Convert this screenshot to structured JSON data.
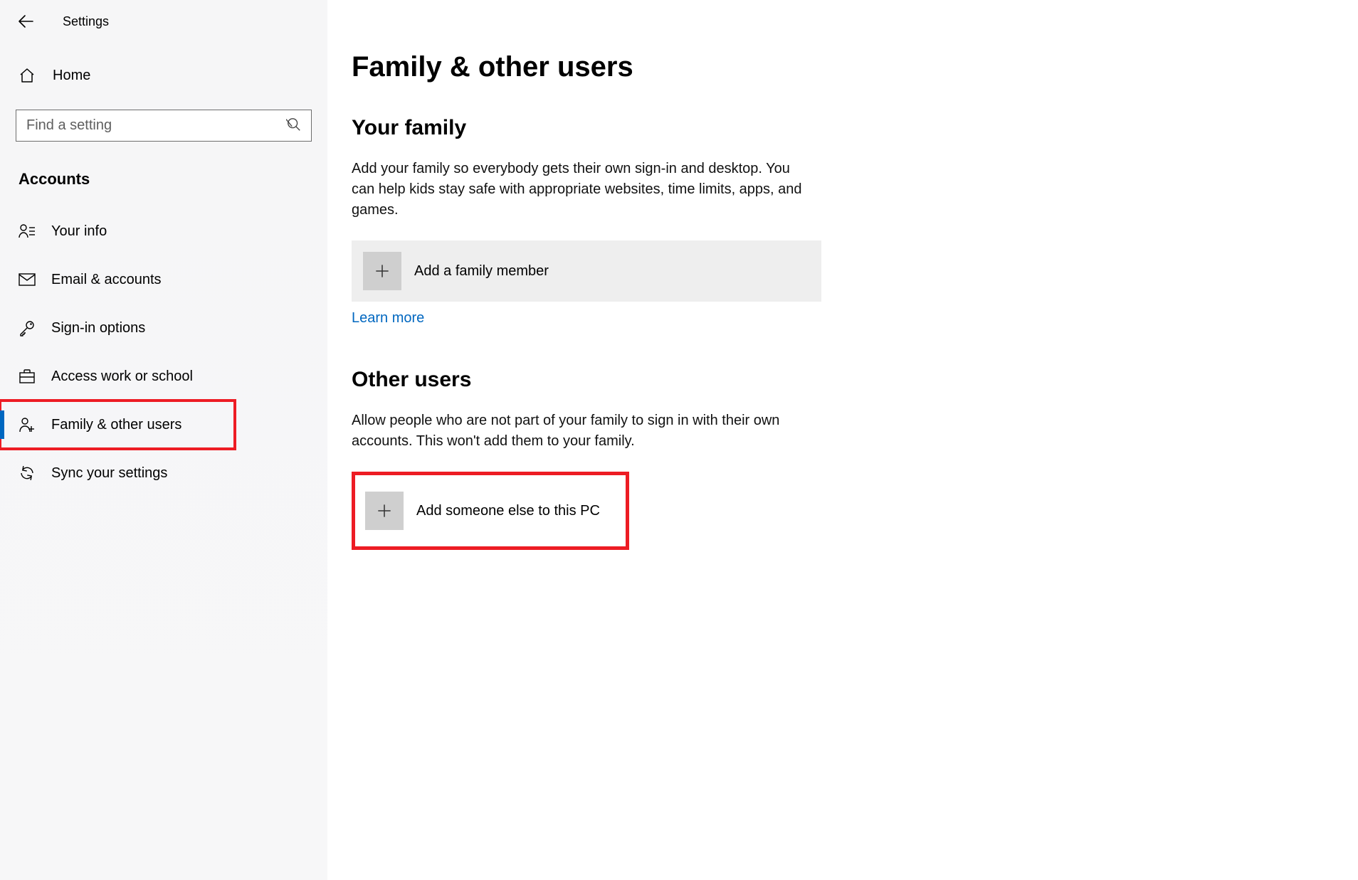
{
  "app": {
    "title": "Settings"
  },
  "sidebar": {
    "home": "Home",
    "search_placeholder": "Find a setting",
    "section": "Accounts",
    "items": [
      {
        "label": "Your info"
      },
      {
        "label": "Email & accounts"
      },
      {
        "label": "Sign-in options"
      },
      {
        "label": "Access work or school"
      },
      {
        "label": "Family & other users"
      },
      {
        "label": "Sync your settings"
      }
    ]
  },
  "page": {
    "title": "Family & other users",
    "family": {
      "heading": "Your family",
      "desc": "Add your family so everybody gets their own sign-in and desktop. You can help kids stay safe with appropriate websites, time limits, apps, and games.",
      "add_label": "Add a family member",
      "learn_more": "Learn more"
    },
    "other": {
      "heading": "Other users",
      "desc": "Allow people who are not part of your family to sign in with their own accounts. This won't add them to your family.",
      "add_label": "Add someone else to this PC"
    }
  }
}
